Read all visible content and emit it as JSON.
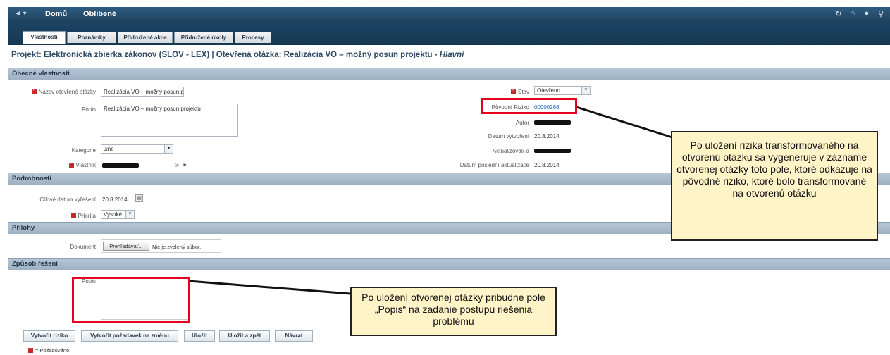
{
  "topbar": {
    "back_arrow": "◄ ▾",
    "home": "Domů",
    "favorites": "Oblíbené",
    "icons": [
      "refresh-icon",
      "home-icon",
      "circle-icon",
      "search-icon"
    ]
  },
  "tabs": [
    {
      "label": "Vlastnosti",
      "active": true
    },
    {
      "label": "Poznámky"
    },
    {
      "label": "Přidružené akce"
    },
    {
      "label": "Přidružené úkoly"
    },
    {
      "label": "Procesy"
    }
  ],
  "title": {
    "main": "Projekt: Elektronická zbierka zákonov (SLOV - LEX) | Otevřená otázka: Realizácia VO – možný posun projektu - ",
    "suffix": "Hlavní"
  },
  "sections": {
    "general": "Obecné vlastnosti",
    "details": "Podrobnosti",
    "attachments": "Přílohy",
    "resolution": "Způsob řešení"
  },
  "general": {
    "name_label": "Název otevřené otázky",
    "name_value": "Realizácia VO – možný posun p",
    "desc_label": "Popis",
    "desc_value": "Realizácia VO – možný posun projektu",
    "category_label": "Kategorie",
    "category_value": "Jiné",
    "owner_label": "Vlastník",
    "state_label": "Stav",
    "state_value": "Otevřeno",
    "orig_risk_label": "Původní Riziko",
    "orig_risk_value": "00000268",
    "author_label": "Autor",
    "created_label": "Datum vytvoření",
    "created_value": "20.8.2014",
    "updated_by_label": "Aktualizoval/-a",
    "last_update_label": "Datum poslední aktualizace",
    "last_update_value": "20.8.2014"
  },
  "details": {
    "target_date_label": "Cílové datum vyřešení",
    "target_date_value": "20.8.2014",
    "priority_label": "Priorita",
    "priority_value": "Vysoké"
  },
  "attachments": {
    "document_label": "Dokument",
    "browse_button": "Prehľadávať...",
    "no_file": "Nie je zvolený súbor."
  },
  "resolution": {
    "desc_label": "Popis"
  },
  "buttons": {
    "create_risk": "Vytvořit riziko",
    "create_change": "Vytvořit požadavek na změnu",
    "save": "Uložit",
    "save_back": "Uložit a zpět",
    "back": "Návrat"
  },
  "legend": "= Požadováno",
  "callouts": {
    "risk": "Po uložení rizika transformovaného na otvorenú otázku sa vygeneruje v zázname otvorenej otázky toto pole, ktoré odkazuje na pôvodné riziko, ktoré bolo transformované na otvorenú otázku",
    "desc": "Po uložení otvorenej otázky pribudne pole „Popis“ na zadanie postupu riešenia problému"
  },
  "colors": {
    "header_dark": "#1c3f5c",
    "section_bar": "#a9bbcd",
    "highlight_red": "#e3001b",
    "callout_bg": "#fff3c8"
  }
}
